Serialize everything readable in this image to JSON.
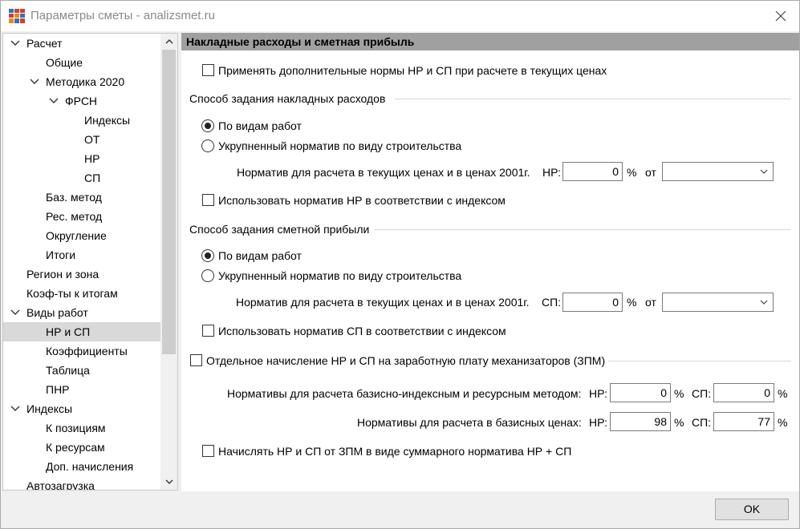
{
  "window": {
    "title": "Параметры сметы - analizsmet.ru"
  },
  "tree": {
    "items": [
      {
        "label": "Расчет",
        "expanded": true
      },
      {
        "label": "Общие"
      },
      {
        "label": "Методика 2020",
        "expanded": true
      },
      {
        "label": "ФРСН",
        "expanded": true
      },
      {
        "label": "Индексы"
      },
      {
        "label": "ОТ"
      },
      {
        "label": "НР"
      },
      {
        "label": "СП"
      },
      {
        "label": "Баз. метод"
      },
      {
        "label": "Рес. метод"
      },
      {
        "label": "Округление"
      },
      {
        "label": "Итоги"
      },
      {
        "label": "Регион и зона"
      },
      {
        "label": "Коэф-ты к итогам"
      },
      {
        "label": "Виды работ",
        "expanded": true
      },
      {
        "label": "НР и СП",
        "selected": true
      },
      {
        "label": "Коэффициенты"
      },
      {
        "label": "Таблица"
      },
      {
        "label": "ПНР"
      },
      {
        "label": "Индексы",
        "expanded": true
      },
      {
        "label": "К позициям"
      },
      {
        "label": "К ресурсам"
      },
      {
        "label": "Доп. начисления"
      },
      {
        "label": "Автозагрузка"
      }
    ]
  },
  "main": {
    "header": "Накладные расходы и сметная прибыль",
    "apply_extra_label": "Применять дополнительные нормы НР и СП при расчете в текущих ценах",
    "nr_group": {
      "title": "Способ задания накладных расходов",
      "radio1": "По видам работ",
      "radio2": "Укрупненный норматив по виду строительства",
      "norm_label": "Норматив для расчета в текущих ценах и в ценах 2001г.",
      "short": "НР:",
      "value": "0",
      "pct": "%",
      "from": "от",
      "use_index_label": "Использовать норматив НР в соответствии с индексом"
    },
    "sp_group": {
      "title": "Способ задания сметной прибыли",
      "radio1": "По видам работ",
      "radio2": "Укрупненный норматив по виду строительства",
      "norm_label": "Норматив для расчета в текущих ценах и в ценах 2001г.",
      "short": "СП:",
      "value": "0",
      "pct": "%",
      "from": "от",
      "use_index_label": "Использовать норматив СП в соответствии с индексом"
    },
    "zpm": {
      "title": "Отдельное начисление НР и СП на заработную плату механизаторов (ЗПМ)",
      "row1_label": "Нормативы для расчета базисно-индексным и ресурсным методом:",
      "row2_label": "Нормативы для расчета в базисных ценах:",
      "nr_short": "НР:",
      "sp_short": "СП:",
      "pct": "%",
      "row1_nr": "0",
      "row1_sp": "0",
      "row2_nr": "98",
      "row2_sp": "77",
      "sum_label": "Начислять НР и СП от ЗПМ в виде суммарного норматива НР + СП"
    }
  },
  "footer": {
    "ok_label": "OK"
  }
}
